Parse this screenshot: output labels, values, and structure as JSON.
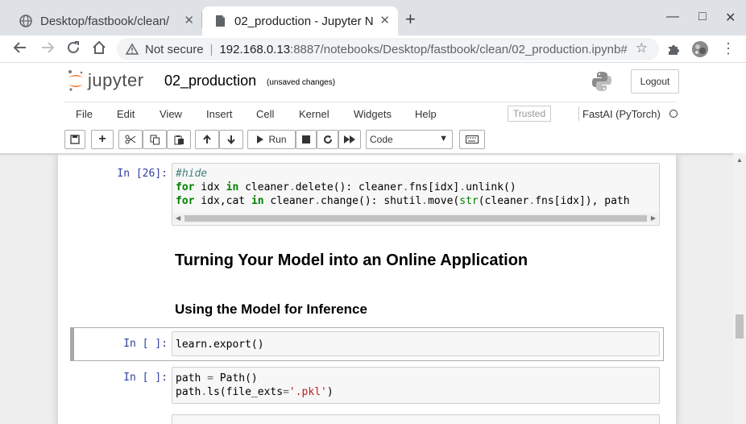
{
  "browser": {
    "tabs": [
      {
        "title": "Desktop/fastbook/clean/",
        "close": "✕",
        "favicon": "globe-icon"
      },
      {
        "title": "02_production - Jupyter N",
        "close": "✕",
        "favicon": "notebook-icon"
      }
    ],
    "new_tab": "+",
    "window_controls": {
      "minimize": "—",
      "maximize": "□",
      "close": "✕"
    },
    "address": {
      "security_label": "Not secure",
      "separator": "|",
      "host": "192.168.0.13",
      "rest": ":8887/notebooks/Desktop/fastbook/clean/02_production.ipynb#"
    }
  },
  "jupyter": {
    "logo_text": "jupyter",
    "notebook_name": "02_production",
    "save_status": "(unsaved changes)",
    "logout_label": "Logout",
    "menu": [
      "File",
      "Edit",
      "View",
      "Insert",
      "Cell",
      "Kernel",
      "Widgets",
      "Help"
    ],
    "trusted_label": "Trusted",
    "kernel_name": "FastAI (PyTorch)",
    "toolbar": {
      "run_label": "Run",
      "cell_type": "Code"
    }
  },
  "notebook": {
    "cell1": {
      "prompt": "In [26]:",
      "line1_comment": "#hide",
      "line2": {
        "kw1": "for",
        "a": " idx ",
        "kw2": "in",
        "b": " cleaner",
        "dot": ".",
        "c": "delete(): cleaner",
        "d": ".",
        "e": "fns[idx]",
        "f": ".",
        "g": "unlink()"
      },
      "line3": {
        "kw1": "for",
        "a": " idx,cat ",
        "kw2": "in",
        "b": " cleaner",
        "c": ".",
        "d": "change(): shutil",
        "e": ".",
        "f": "move(",
        "bi": "str",
        "g": "(cleaner",
        "h": ".",
        "i": "fns[idx]), path"
      }
    },
    "heading1": "Turning Your Model into an Online Application",
    "heading2": "Using the Model for Inference",
    "cell2": {
      "prompt": "In [ ]:",
      "code": "learn.export()"
    },
    "cell3": {
      "prompt": "In [ ]:",
      "line1": {
        "a": "path ",
        "eq": "=",
        "b": " Path()"
      },
      "line2": {
        "a": "path",
        "dot": ".",
        "b": "ls(file_exts",
        "eq": "=",
        "str": "'.pkl'",
        "c": ")"
      }
    }
  },
  "colors": {
    "prompt_blue": "#303f9f",
    "keyword_green": "#008000",
    "comment_teal": "#408080",
    "string_red": "#ba2121"
  }
}
